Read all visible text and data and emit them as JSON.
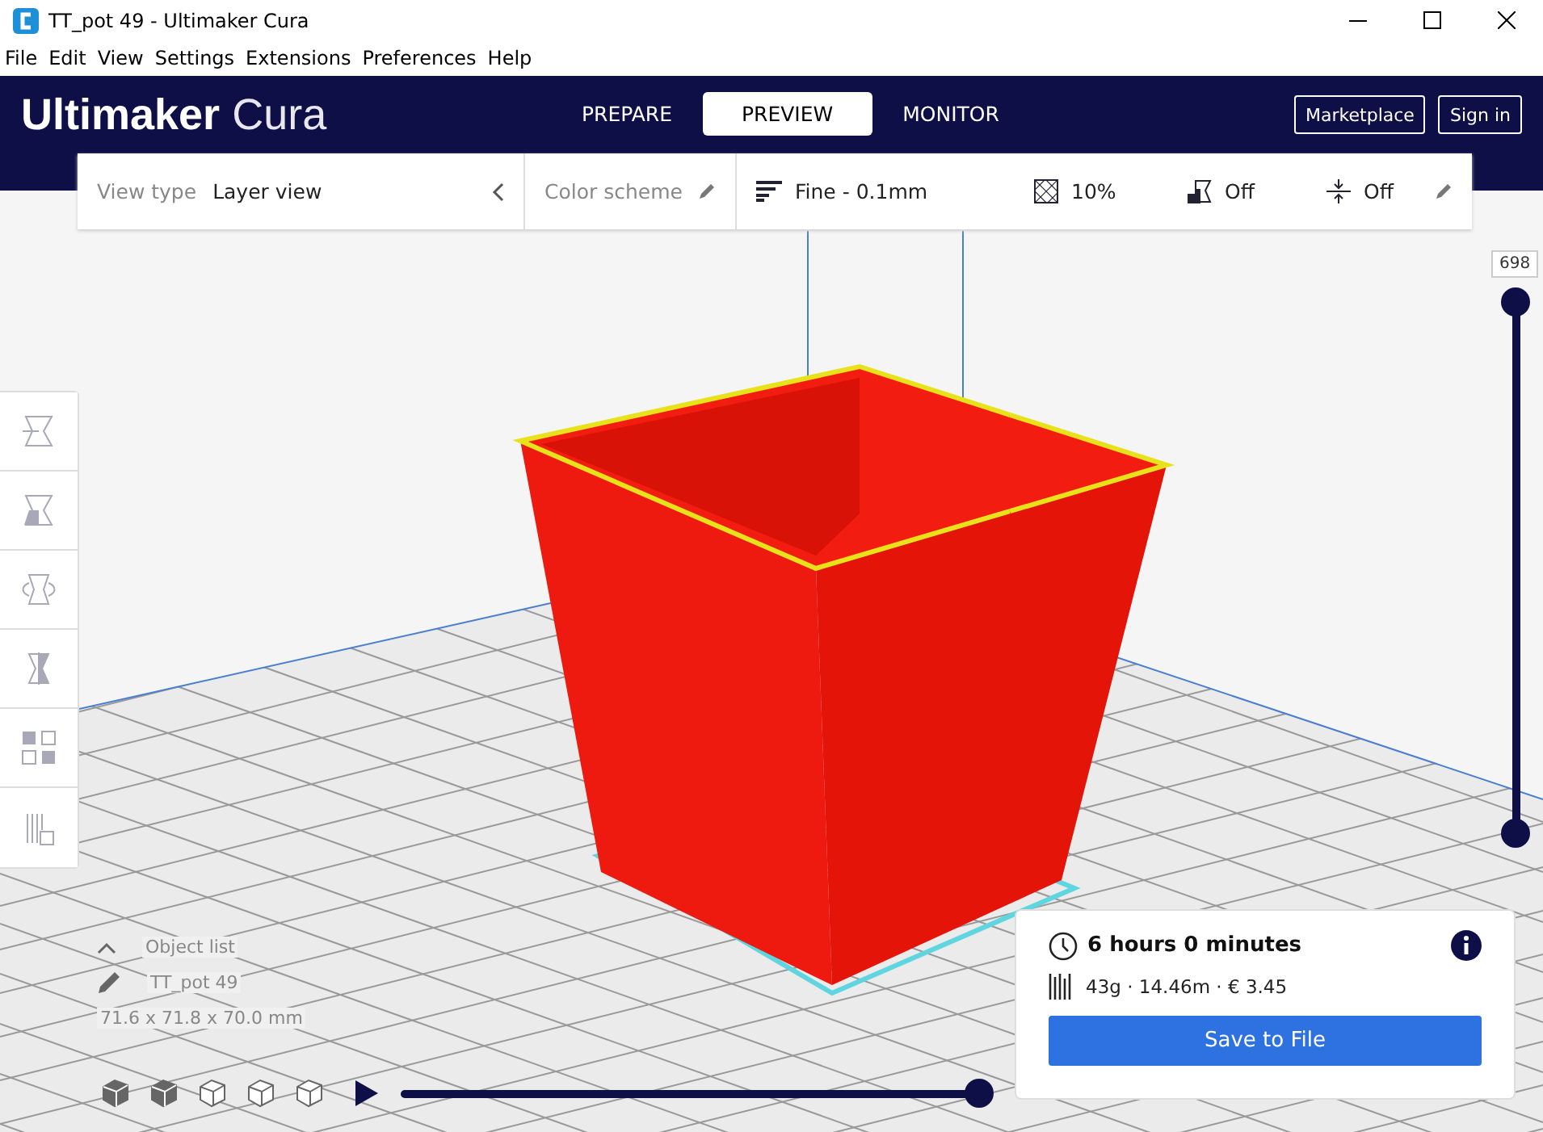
{
  "window": {
    "title": "TT_pot 49 - Ultimaker Cura"
  },
  "menu": [
    "File",
    "Edit",
    "View",
    "Settings",
    "Extensions",
    "Preferences",
    "Help"
  ],
  "header": {
    "logo_bold": "Ultimaker",
    "logo_light": "Cura",
    "stages": [
      {
        "label": "PREPARE",
        "selected": false
      },
      {
        "label": "PREVIEW",
        "selected": true
      },
      {
        "label": "MONITOR",
        "selected": false
      }
    ],
    "buttons": [
      "Marketplace",
      "Sign in"
    ]
  },
  "toolbar": {
    "view_type_label": "View type",
    "view_type": "Layer view",
    "color_scheme": "Color scheme",
    "profile": "Fine - 0.1mm",
    "infill": "10%",
    "support": "Off",
    "adhesion": "Off"
  },
  "layer_slider": {
    "value": "698",
    "handles": [
      {
        "level": 1
      },
      {
        "level": 0
      }
    ]
  },
  "object_list": {
    "label": "Object list",
    "name": "TT_pot 49",
    "dimensions": "71.6 x 71.8 x 70.0 mm"
  },
  "simulation": {
    "level": 1
  },
  "print_info": {
    "time": "6 hours 0 minutes",
    "material": "43g · 14.46m · € 3.45",
    "button": "Save to File"
  }
}
